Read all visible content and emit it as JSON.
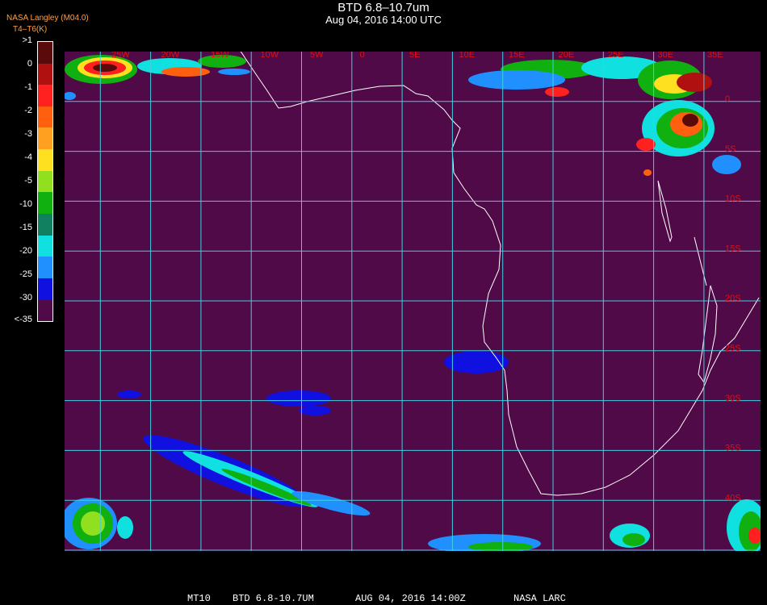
{
  "title": "BTD 6.8–10.7um",
  "subtitle": "Aug 04, 2016 14:00 UTC",
  "credit_line1": "NASA Langley (M04.0)",
  "credit_line2": "T4–T6(K)",
  "legend": {
    "labels": [
      ">1",
      "0",
      "-1",
      "-2",
      "-3",
      "-4",
      "-5",
      "-10",
      "-15",
      "-20",
      "-25",
      "-30",
      "<-35"
    ],
    "colors": [
      "#5a0a0a",
      "#b01010",
      "#ff2020",
      "#ff6010",
      "#ffa020",
      "#ffe020",
      "#90e020",
      "#10b010",
      "#108060",
      "#10e0e0",
      "#2090ff",
      "#1010e0",
      "#500a48"
    ]
  },
  "map": {
    "background_color": "#500a48",
    "grid_color": "#40d0e0",
    "lon_labels": [
      "25W",
      "20W",
      "15W",
      "10W",
      "5W",
      "0",
      "5E",
      "10E",
      "15E",
      "20E",
      "25E",
      "30E",
      "35E"
    ],
    "lat_labels": [
      "0",
      "5S",
      "10S",
      "15S",
      "20S",
      "25S",
      "30S",
      "35S",
      "40S"
    ],
    "label_color": "#e01010"
  },
  "footer": {
    "product": "MT10",
    "channel": "BTD 6.8-10.7UM",
    "datetime": "AUG 04, 2016 14:00Z",
    "source": "NASA LARC"
  }
}
